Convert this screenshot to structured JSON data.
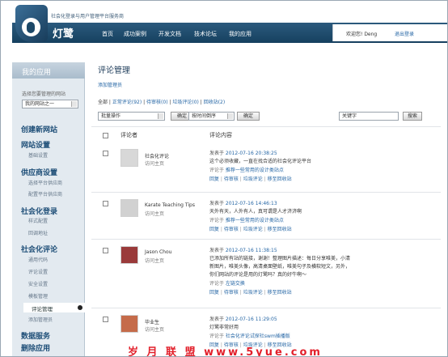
{
  "header": {
    "tagline": "社会化登录与用户管理平台服务商",
    "brand": "灯鹭",
    "nav": [
      "首页",
      "成功案例",
      "开发文档",
      "技术论坛",
      "我的应用"
    ],
    "welcome": "欢迎您! Deng",
    "logout": "退出登录"
  },
  "sidebar": {
    "section_title": "我的应用",
    "choose_label": "选择您要管理的网站",
    "site_select": "我的网站之一",
    "items": [
      {
        "label": "创建新网站",
        "level": "section"
      },
      {
        "label": "网站设置",
        "level": "section"
      },
      {
        "label": "基础设置",
        "level": "sub"
      },
      {
        "label": "供应商设置",
        "level": "section"
      },
      {
        "label": "选择平台供应商",
        "level": "sub"
      },
      {
        "label": "配置平台供应商",
        "level": "sub"
      },
      {
        "label": "社会化登录",
        "level": "section"
      },
      {
        "label": "样式配置",
        "level": "sub"
      },
      {
        "label": "回调地址",
        "level": "sub"
      },
      {
        "label": "社会化评论",
        "level": "section"
      },
      {
        "label": "通用代码",
        "level": "sub"
      },
      {
        "label": "评论设置",
        "level": "sub"
      },
      {
        "label": "安全设置",
        "level": "sub"
      },
      {
        "label": "模板管理",
        "level": "sub"
      },
      {
        "label": "评论管理",
        "level": "active"
      },
      {
        "label": "添加管理员",
        "level": "sub"
      },
      {
        "label": "数据服务",
        "level": "section"
      },
      {
        "label": "删除应用",
        "level": "section"
      }
    ]
  },
  "main": {
    "title": "评论管理",
    "add_admin": "添加管理员",
    "filters": [
      {
        "label": "全部",
        "count": "",
        "sep": "|"
      },
      {
        "label": "正常评论",
        "count": "(92)",
        "sep": "|"
      },
      {
        "label": "待审核",
        "count": "(0)",
        "sep": "|"
      },
      {
        "label": "垃圾评论",
        "count": "(0)",
        "sep": "|"
      },
      {
        "label": "回收站",
        "count": "(2)",
        "sep": ""
      }
    ],
    "bulk_select": "批量操作",
    "sort_select": "按时间倒序",
    "confirm": "确定",
    "search_value": "关键字",
    "search_button": "搜索",
    "col_commenter": "评论者",
    "col_content": "评论内容",
    "visit_home": "访问主页",
    "published_prefix": "发表于",
    "comment_on": "评论于",
    "actions": [
      {
        "label": "回复",
        "sep": "|"
      },
      {
        "label": "待审核",
        "sep": "|"
      },
      {
        "label": "垃圾评论",
        "sep": "|"
      },
      {
        "label": "移至回收站",
        "sep": ""
      }
    ]
  },
  "comments": [
    {
      "name": "社会化评论",
      "time": "2012-07-16 20:38:25",
      "text": [
        "这个必须收藏，一直在找合适的社会化评论平台"
      ],
      "target": "推荐一些常用的设计类站点"
    },
    {
      "name": "Karate Teaching Tips",
      "time": "2012-07-16 14:46:13",
      "text": [
        "天外有天，人外有人，真可谓是人才济济啊"
      ],
      "target": "推荐一些常用的设计类站点"
    },
    {
      "name": "Jason Chou",
      "time": "2012-07-16 11:38:15",
      "text": [
        "已添加所有站的链接，谢谢！整理图片描述：每日分享唯美，小清",
        "新图片，唯美头像，高清桌面壁纸，唯美句子及横软短文，另外，",
        "你们网站的评论是用的灯鹭吗？真的好牛啊～"
      ],
      "target": "左链交换"
    },
    {
      "name": "毕业生",
      "time": "2012-07-16 11:29:05",
      "text": [
        "灯鹭非常好用"
      ],
      "target": "社会化评论试探社swm插播版"
    }
  ],
  "watermark": "岁 月 联 盟  www.5yue.com"
}
